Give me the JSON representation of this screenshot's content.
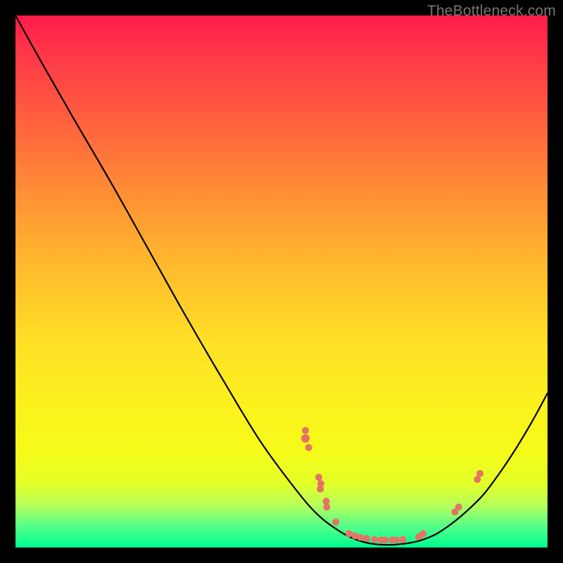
{
  "watermark": "TheBottleneck.com",
  "colors": {
    "page_bg": "#000000",
    "curve_stroke": "#000000",
    "marker_fill": "#e57366",
    "watermark_text": "#777777"
  },
  "chart_data": {
    "type": "line",
    "title": "",
    "xlabel": "",
    "ylabel": "",
    "xlim": [
      0,
      100
    ],
    "ylim": [
      0,
      100
    ],
    "note": "Axes, ticks, and units are not shown in the image; x/y are in percent of plot area (0 at left/bottom). Values estimated from pixel positions.",
    "series": [
      {
        "name": "bottleneck-curve",
        "x": [
          0,
          5,
          11,
          18,
          25,
          32,
          39,
          46,
          53,
          57,
          61,
          64,
          67,
          70,
          73,
          76,
          79,
          82,
          85,
          88,
          91,
          94,
          97,
          100
        ],
        "y": [
          100,
          91,
          80.5,
          68.5,
          56,
          43.5,
          31.5,
          20,
          10.5,
          6,
          3,
          1.5,
          0.7,
          0.5,
          0.7,
          1.3,
          2.5,
          4.5,
          7,
          10,
          14,
          18.5,
          23.5,
          29
        ]
      }
    ],
    "markers": {
      "name": "highlighted-points",
      "points": [
        {
          "x": 54.5,
          "y": 22.0,
          "r": 5
        },
        {
          "x": 54.5,
          "y": 20.5,
          "r": 6
        },
        {
          "x": 55.1,
          "y": 18.8,
          "r": 5
        },
        {
          "x": 57.0,
          "y": 13.2,
          "r": 5
        },
        {
          "x": 57.4,
          "y": 12.0,
          "r": 5
        },
        {
          "x": 57.3,
          "y": 11.0,
          "r": 5
        },
        {
          "x": 58.4,
          "y": 8.7,
          "r": 5
        },
        {
          "x": 58.5,
          "y": 7.6,
          "r": 5
        },
        {
          "x": 60.2,
          "y": 4.8,
          "r": 5
        },
        {
          "x": 62.7,
          "y": 2.6,
          "r": 5
        },
        {
          "x": 63.8,
          "y": 2.2,
          "r": 5
        },
        {
          "x": 64.8,
          "y": 1.9,
          "r": 5
        },
        {
          "x": 66.0,
          "y": 1.7,
          "r": 5
        },
        {
          "x": 67.5,
          "y": 1.5,
          "r": 5
        },
        {
          "x": 68.7,
          "y": 1.4,
          "r": 5
        },
        {
          "x": 69.5,
          "y": 1.4,
          "r": 5
        },
        {
          "x": 70.8,
          "y": 1.4,
          "r": 5
        },
        {
          "x": 71.6,
          "y": 1.4,
          "r": 5
        },
        {
          "x": 72.8,
          "y": 1.5,
          "r": 5
        },
        {
          "x": 75.8,
          "y": 2.0,
          "r": 5
        },
        {
          "x": 76.6,
          "y": 2.6,
          "r": 5
        },
        {
          "x": 82.6,
          "y": 6.7,
          "r": 5
        },
        {
          "x": 83.3,
          "y": 7.6,
          "r": 5
        },
        {
          "x": 86.8,
          "y": 12.8,
          "r": 5
        },
        {
          "x": 87.3,
          "y": 13.9,
          "r": 5
        }
      ]
    }
  }
}
